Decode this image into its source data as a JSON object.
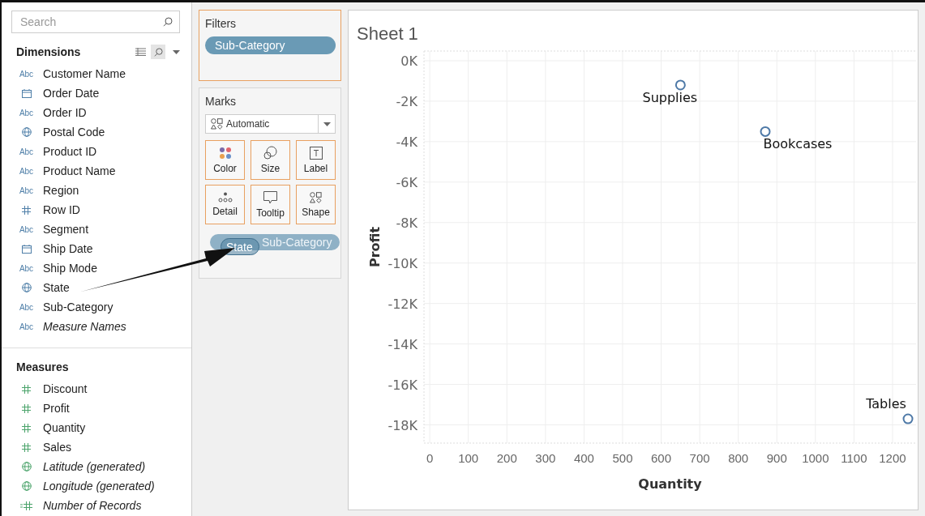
{
  "search": {
    "placeholder": "Search"
  },
  "dimensions": {
    "title": "Dimensions",
    "items": [
      {
        "label": "Customer Name",
        "kind": "string",
        "type_text": "Abc",
        "italic": false
      },
      {
        "label": "Order Date",
        "kind": "date",
        "italic": false
      },
      {
        "label": "Order ID",
        "kind": "string",
        "type_text": "Abc",
        "italic": false
      },
      {
        "label": "Postal Code",
        "kind": "geo",
        "italic": false
      },
      {
        "label": "Product ID",
        "kind": "string",
        "type_text": "Abc",
        "italic": false
      },
      {
        "label": "Product Name",
        "kind": "string",
        "type_text": "Abc",
        "italic": false
      },
      {
        "label": "Region",
        "kind": "string",
        "type_text": "Abc",
        "italic": false
      },
      {
        "label": "Row ID",
        "kind": "number",
        "italic": false
      },
      {
        "label": "Segment",
        "kind": "string",
        "type_text": "Abc",
        "italic": false
      },
      {
        "label": "Ship Date",
        "kind": "date",
        "italic": false
      },
      {
        "label": "Ship Mode",
        "kind": "string",
        "type_text": "Abc",
        "italic": false
      },
      {
        "label": "State",
        "kind": "geo",
        "italic": false
      },
      {
        "label": "Sub-Category",
        "kind": "string",
        "type_text": "Abc",
        "italic": false
      },
      {
        "label": "Measure Names",
        "kind": "string",
        "type_text": "Abc",
        "italic": true
      }
    ]
  },
  "measures": {
    "title": "Measures",
    "items": [
      {
        "label": "Discount",
        "kind": "number",
        "italic": false
      },
      {
        "label": "Profit",
        "kind": "number",
        "italic": false
      },
      {
        "label": "Quantity",
        "kind": "number",
        "italic": false
      },
      {
        "label": "Sales",
        "kind": "number",
        "italic": false
      },
      {
        "label": "Latitude (generated)",
        "kind": "geo",
        "italic": true
      },
      {
        "label": "Longitude (generated)",
        "kind": "geo",
        "italic": true
      },
      {
        "label": "Number of Records",
        "kind": "count",
        "italic": true
      }
    ]
  },
  "filters": {
    "title": "Filters",
    "pills": [
      {
        "label": "Sub-Category"
      }
    ]
  },
  "marks": {
    "title": "Marks",
    "mark_type": "Automatic",
    "buttons": [
      {
        "label": "Color",
        "kind": "color"
      },
      {
        "label": "Size",
        "kind": "size"
      },
      {
        "label": "Label",
        "kind": "label"
      },
      {
        "label": "Detail",
        "kind": "detail"
      },
      {
        "label": "Tooltip",
        "kind": "tooltip"
      },
      {
        "label": "Shape",
        "kind": "shape"
      }
    ],
    "shelf_pill": {
      "label": "Sub-Category"
    },
    "drag_pill": {
      "label": "State"
    }
  },
  "sheet": {
    "title": "Sheet 1",
    "chart_data": {
      "type": "scatter",
      "xlabel": "Quantity",
      "ylabel": "Profit",
      "x": [
        650,
        870,
        1240
      ],
      "grid": true,
      "series": [
        {
          "color": "#4e79a7",
          "values": [
            -1200,
            -3500,
            -17700
          ]
        }
      ],
      "xlim": [
        -15,
        1261
      ],
      "ylim": [
        -18900,
        480
      ],
      "xticks": [
        0,
        100,
        200,
        300,
        400,
        500,
        600,
        700,
        800,
        900,
        1000,
        1100,
        1200
      ],
      "yticks": [
        {
          "value": 0,
          "label": "0K"
        },
        {
          "value": -2000,
          "label": "-2K"
        },
        {
          "value": -4000,
          "label": "-4K"
        },
        {
          "value": -6000,
          "label": "-6K"
        },
        {
          "value": -8000,
          "label": "-8K"
        },
        {
          "value": -10000,
          "label": "-10K"
        },
        {
          "value": -12000,
          "label": "-12K"
        },
        {
          "value": -14000,
          "label": "-14K"
        },
        {
          "value": -16000,
          "label": "-16K"
        },
        {
          "value": -18000,
          "label": "-18K"
        }
      ],
      "annotations": [
        "Supplies",
        "Bookcases",
        "Tables"
      ]
    }
  }
}
